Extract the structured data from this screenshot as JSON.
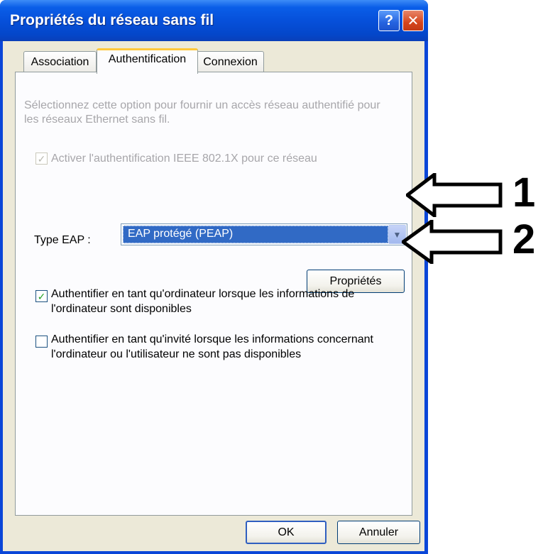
{
  "window": {
    "title": "Propriétés du réseau sans fil",
    "help_glyph": "?",
    "close_glyph": "✕"
  },
  "tabs": [
    {
      "label": "Association",
      "active": false
    },
    {
      "label": "Authentification",
      "active": true
    },
    {
      "label": "Connexion",
      "active": false
    }
  ],
  "auth": {
    "description": "Sélectionnez cette option pour fournir un accès réseau authentifié pour les réseaux Ethernet sans fil.",
    "ieee_checkbox": {
      "label": "Activer l'authentification IEEE 802.1X pour ce réseau",
      "checked": true,
      "enabled": false
    },
    "eap_type_label": "Type EAP :",
    "eap_type_value": "EAP protégé (PEAP)",
    "properties_button": "Propriétés",
    "computer_auth_checkbox": {
      "label_line1": "Authentifier en tant qu'ordinateur lorsque les informations de",
      "label_line2": "l'ordinateur sont disponibles",
      "checked": true
    },
    "guest_auth_checkbox": {
      "label_line1": "Authentifier en tant qu'invité lorsque les informations concernant",
      "label_line2": "l'ordinateur ou l'utilisateur ne sont pas disponibles",
      "checked": false
    }
  },
  "footer": {
    "ok_button": "OK",
    "cancel_button": "Annuler"
  },
  "callouts": [
    "1",
    "2"
  ],
  "colors": {
    "titlebar": "#0a5ee8",
    "selection": "#316ac5",
    "tab_highlight": "#ffc83c",
    "checkmark": "#21a121"
  }
}
